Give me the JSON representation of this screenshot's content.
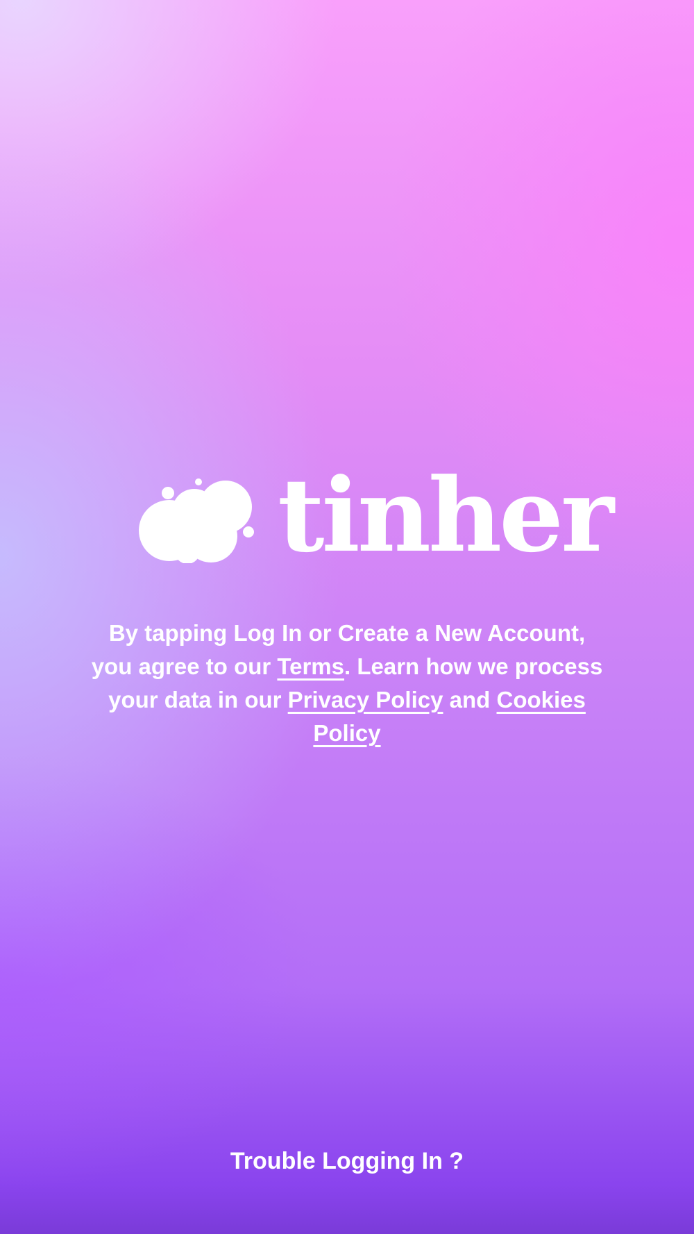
{
  "app": {
    "brand_name": "tinher",
    "logo_icon": "cloud-blob-icon",
    "colors": {
      "gradient_top_left": "#e8d8ff",
      "gradient_top_right": "#fa82fa",
      "gradient_mid": "#c982f7",
      "gradient_bottom": "#8a44ee",
      "text": "#ffffff"
    }
  },
  "legal": {
    "text_1": "By tapping Log In or Create a New Account, you agree to our ",
    "terms_link": "Terms",
    "text_2": ". Learn how we process your data in our ",
    "privacy_link": "Privacy Policy",
    "text_3": " and ",
    "cookies_link": "Cookies Policy"
  },
  "footer": {
    "trouble_link": "Trouble Logging In ?"
  }
}
